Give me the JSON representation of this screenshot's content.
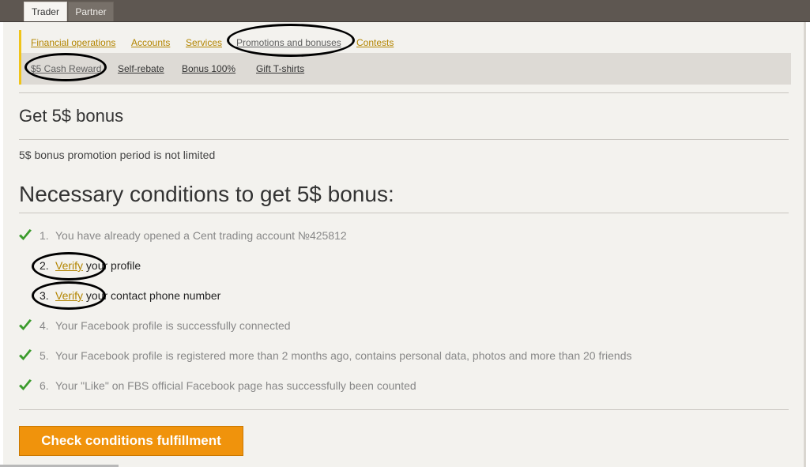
{
  "top_tabs": {
    "trader": "Trader",
    "partner": "Partner"
  },
  "nav": {
    "primary": [
      "Financial operations",
      "Accounts",
      "Services",
      "Promotions and bonuses",
      "Contests"
    ],
    "secondary": [
      "$5 Cash Reward",
      "Self-rebate",
      "Bonus 100%",
      "Gift T-shirts"
    ]
  },
  "page": {
    "title": "Get 5$ bonus",
    "promo_period": "5$ bonus promotion period is not limited",
    "conditions_heading": "Necessary conditions to get 5$ bonus:"
  },
  "conditions": [
    {
      "num": "1.",
      "text": "You have already opened a Cent trading account №425812",
      "status": "done"
    },
    {
      "num": "2.",
      "link": "Verify",
      "text": " your profile",
      "status": "todo"
    },
    {
      "num": "3.",
      "link": "Verify",
      "text": " your contact phone number",
      "status": "todo"
    },
    {
      "num": "4.",
      "text": "Your Facebook profile is successfully connected",
      "status": "done"
    },
    {
      "num": "5.",
      "text": "Your Facebook profile is registered more than 2 months ago, contains personal data, photos and more than 20 friends",
      "status": "done"
    },
    {
      "num": "6.",
      "text": "Your \"Like\" on FBS official Facebook page has successfully been counted",
      "status": "done"
    }
  ],
  "check_button": "Check conditions fulfillment",
  "colors": {
    "accent": "#f0930c",
    "link": "#b38500",
    "check": "#3b9b2c",
    "nav_border": "#f0c419"
  },
  "icons": {
    "check": "check-icon"
  }
}
